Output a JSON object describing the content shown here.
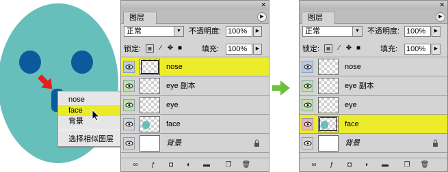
{
  "context_menu": {
    "items": [
      "nose",
      "face",
      "背景"
    ],
    "selected_index": 1,
    "extra_item": "选择相似图层"
  },
  "panels": [
    {
      "tab": "图层",
      "blend_mode": "正常",
      "opacity_label": "不透明度:",
      "opacity_value": "100%",
      "lock_label": "锁定:",
      "fill_label": "填充:",
      "fill_value": "100%",
      "layers": [
        {
          "name": "nose",
          "selected": true,
          "thumb": "transparent-boxed"
        },
        {
          "name": "eye 副本",
          "selected": false,
          "thumb": "transparent"
        },
        {
          "name": "eye",
          "selected": false,
          "thumb": "transparent"
        },
        {
          "name": "face",
          "selected": false,
          "thumb": "face"
        },
        {
          "name": "背景",
          "selected": false,
          "thumb": "white",
          "locked": true
        }
      ]
    },
    {
      "tab": "图层",
      "blend_mode": "正常",
      "opacity_label": "不透明度:",
      "opacity_value": "100%",
      "lock_label": "锁定:",
      "fill_label": "填充:",
      "fill_value": "100%",
      "layers": [
        {
          "name": "nose",
          "selected": false,
          "thumb": "transparent"
        },
        {
          "name": "eye 副本",
          "selected": false,
          "thumb": "transparent"
        },
        {
          "name": "eye",
          "selected": false,
          "thumb": "transparent"
        },
        {
          "name": "face",
          "selected": true,
          "thumb": "face-boxed"
        },
        {
          "name": "背景",
          "selected": false,
          "thumb": "white",
          "locked": true
        }
      ]
    }
  ],
  "colors": {
    "face": "#66bfba",
    "eyes": "#0a5a9c",
    "selection": "#ecec2a",
    "arrow_red": "#e3201b",
    "arrow_green": "#6cc13a"
  }
}
